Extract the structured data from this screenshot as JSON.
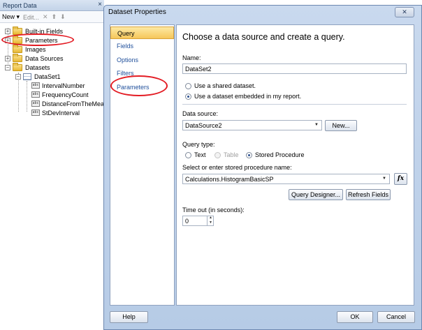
{
  "report_data": {
    "title": "Report Data",
    "close_glyph": "×",
    "toolbar": {
      "new_label": "New ▾",
      "edit_label": "Edit..."
    },
    "tree": {
      "built_in_fields": "Built-in Fields",
      "parameters": "Parameters",
      "images": "Images",
      "data_sources": "Data Sources",
      "datasets": "Datasets",
      "dataset1": "DataSet1",
      "fields": [
        "IntervalNumber",
        "FrequencyCount",
        "DistanceFromTheMea",
        "StDevInterval"
      ],
      "field_icon_text": "abc"
    }
  },
  "dialog": {
    "title": "Dataset Properties",
    "close_glyph": "✕",
    "nav": [
      "Query",
      "Fields",
      "Options",
      "Filters",
      "Parameters"
    ],
    "selected_nav": "Query",
    "content": {
      "heading": "Choose a data source and create a query.",
      "name_label": "Name:",
      "name_value": "DataSet2",
      "radio_shared": "Use a shared dataset.",
      "radio_embedded": "Use a dataset embedded in my report.",
      "data_source_label": "Data source:",
      "data_source_value": "DataSource2",
      "new_button": "New...",
      "query_type_label": "Query type:",
      "qt_text": "Text",
      "qt_table": "Table",
      "qt_sp": "Stored Procedure",
      "sp_label": "Select or enter stored procedure name:",
      "sp_value": "Calculations.HistogramBasicSP",
      "fx_label": "fx",
      "query_designer_button": "Query Designer...",
      "refresh_fields_button": "Refresh Fields",
      "timeout_label": "Time out (in seconds):",
      "timeout_value": "0"
    },
    "help_button": "Help",
    "ok_button": "OK",
    "cancel_button": "Cancel"
  },
  "colors": {
    "annotation_red": "#e31b23",
    "nav_selected": "#f6c75a",
    "dialog_frame": "#b6cbe6"
  }
}
